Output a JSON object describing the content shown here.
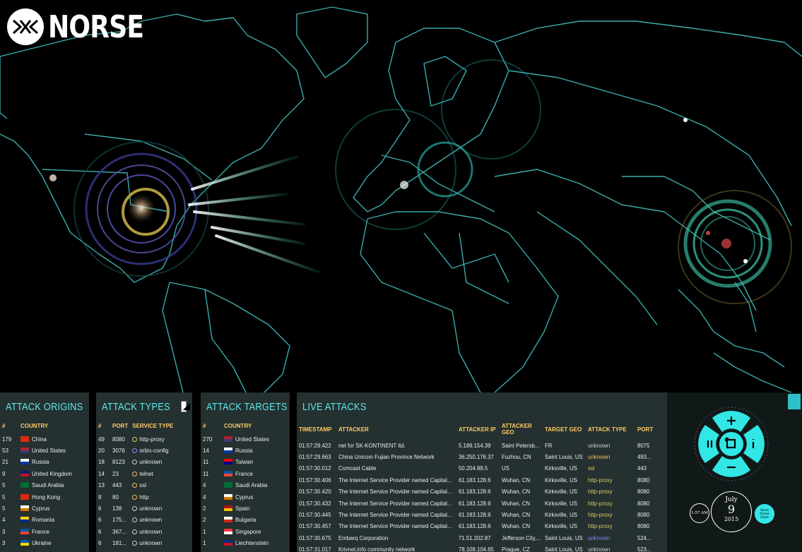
{
  "brand": {
    "name": "NORSE"
  },
  "colors": {
    "accent": "#5fe6e6",
    "header_text": "#ffcc66",
    "map_lines": "#3fb6b6",
    "panel_bg": "#283434"
  },
  "origins": {
    "title": "ATTACK ORIGINS",
    "headers": [
      "#",
      "COUNTRY"
    ],
    "rows": [
      {
        "count": "179",
        "country": "China",
        "flag": "CN"
      },
      {
        "count": "53",
        "country": "United States",
        "flag": "US"
      },
      {
        "count": "21",
        "country": "Russia",
        "flag": "RU"
      },
      {
        "count": "9",
        "country": "United Kingdom",
        "flag": "GB"
      },
      {
        "count": "5",
        "country": "Saudi Arabia",
        "flag": "SA"
      },
      {
        "count": "5",
        "country": "Hong Kong",
        "flag": "HK"
      },
      {
        "count": "5",
        "country": "Cyprus",
        "flag": "CY"
      },
      {
        "count": "4",
        "country": "Romania",
        "flag": "RO"
      },
      {
        "count": "3",
        "country": "France",
        "flag": "FR"
      },
      {
        "count": "3",
        "country": "Ukraine",
        "flag": "UA"
      }
    ]
  },
  "types": {
    "title": "ATTACK TYPES",
    "headers": [
      "#",
      "PORT",
      "SERVICE TYPE"
    ],
    "rows": [
      {
        "count": "49",
        "port": "8080",
        "service": "http-proxy",
        "color": "#d9c96a"
      },
      {
        "count": "20",
        "port": "3076",
        "service": "orbix-config",
        "color": "#8a8af0"
      },
      {
        "count": "18",
        "port": "8123",
        "service": "unknown",
        "color": "#cfcfcf"
      },
      {
        "count": "14",
        "port": "23",
        "service": "telnet",
        "color": "#f0c060"
      },
      {
        "count": "13",
        "port": "443",
        "service": "ssl",
        "color": "#f0c060"
      },
      {
        "count": "8",
        "port": "80",
        "service": "http",
        "color": "#f0c060"
      },
      {
        "count": "6",
        "port": "138",
        "service": "unknown",
        "color": "#cfcfcf"
      },
      {
        "count": "6",
        "port": "175...",
        "service": "unknown",
        "color": "#cfcfcf"
      },
      {
        "count": "6",
        "port": "367...",
        "service": "unknown",
        "color": "#cfcfcf"
      },
      {
        "count": "6",
        "port": "181...",
        "service": "unknown",
        "color": "#cfcfcf"
      }
    ]
  },
  "targets": {
    "title": "ATTACK TARGETS",
    "headers": [
      "#",
      "COUNTRY"
    ],
    "rows": [
      {
        "count": "270",
        "country": "United States",
        "flag": "US"
      },
      {
        "count": "14",
        "country": "Russia",
        "flag": "RU"
      },
      {
        "count": "11",
        "country": "Taiwan",
        "flag": "TW"
      },
      {
        "count": "11",
        "country": "France",
        "flag": "FR"
      },
      {
        "count": "4",
        "country": "Saudi Arabia",
        "flag": "SA"
      },
      {
        "count": "4",
        "country": "Cyprus",
        "flag": "CY"
      },
      {
        "count": "2",
        "country": "Spain",
        "flag": "ES"
      },
      {
        "count": "2",
        "country": "Bulgaria",
        "flag": "BG"
      },
      {
        "count": "1",
        "country": "Singapore",
        "flag": "SG"
      },
      {
        "count": "1",
        "country": "Liechtenstein",
        "flag": "LI"
      }
    ]
  },
  "live": {
    "title": "LIVE ATTACKS",
    "headers": [
      "TIMESTAMP",
      "ATTACKER",
      "ATTACKER IP",
      "ATTACKER GEO",
      "TARGET GEO",
      "ATTACK TYPE",
      "PORT"
    ],
    "rows": [
      {
        "ts": "01:57:29.422",
        "attacker": "net for SK-KONTINENT ltd.",
        "ip": "5.189.154.39",
        "ageo": "Saint Petersb...",
        "tgeo": "FR",
        "type": "unknown",
        "port": "8075",
        "tc": "#cfcfcf"
      },
      {
        "ts": "01:57:29.663",
        "attacker": "China Unicom Fujian Province Network",
        "ip": "36.250.176.37",
        "ageo": "Fuzhou, CN",
        "tgeo": "Saint Louis, US",
        "type": "unknown",
        "port": "493...",
        "tc": "#f0c060"
      },
      {
        "ts": "01:57:30.012",
        "attacker": "Comcast Cable",
        "ip": "50.204.88.5",
        "ageo": "US",
        "tgeo": "Kirksville, US",
        "type": "ssl",
        "port": "443",
        "tc": "#f0c060"
      },
      {
        "ts": "01:57:30.406",
        "attacker": "The Internet Service Provider named Capital...",
        "ip": "61.183.128.6",
        "ageo": "Wuhan, CN",
        "tgeo": "Kirksville, US",
        "type": "http-proxy",
        "port": "8080",
        "tc": "#d9c96a"
      },
      {
        "ts": "01:57:30.420",
        "attacker": "The Internet Service Provider named Capital...",
        "ip": "61.183.128.6",
        "ageo": "Wuhan, CN",
        "tgeo": "Kirksville, US",
        "type": "http-proxy",
        "port": "8080",
        "tc": "#d9c96a"
      },
      {
        "ts": "01:57:30.432",
        "attacker": "The Internet Service Provider named Capital...",
        "ip": "61.183.128.6",
        "ageo": "Wuhan, CN",
        "tgeo": "Kirksville, US",
        "type": "http-proxy",
        "port": "8080",
        "tc": "#d9c96a"
      },
      {
        "ts": "01:57:30.445",
        "attacker": "The Internet Service Provider named Capital...",
        "ip": "61.183.128.6",
        "ageo": "Wuhan, CN",
        "tgeo": "Kirksville, US",
        "type": "http-proxy",
        "port": "8080",
        "tc": "#d9c96a"
      },
      {
        "ts": "01:57:30.457",
        "attacker": "The Internet Service Provider named Capital...",
        "ip": "61.183.128.6",
        "ageo": "Wuhan, CN",
        "tgeo": "Kirksville, US",
        "type": "http-proxy",
        "port": "8080",
        "tc": "#d9c96a"
      },
      {
        "ts": "01:57:30.675",
        "attacker": "Embarq Corporation",
        "ip": "71.51.202.87",
        "ageo": "Jefferson City,...",
        "tgeo": "Saint Louis, US",
        "type": "unknown",
        "port": "524...",
        "tc": "#8a8af0"
      },
      {
        "ts": "01:57:31.017",
        "attacker": "Krivnet.info community network",
        "ip": "78.108.104.65",
        "ageo": "Prague, CZ",
        "tgeo": "Saint Louis, US",
        "type": "unknown",
        "port": "523...",
        "tc": "#cfcfcf"
      }
    ]
  },
  "controls": {
    "time": "1:57 AM",
    "month": "July",
    "day": "9",
    "year": "2015",
    "stats_label": "Show Norse Stats",
    "icons": [
      "zoom-in-icon",
      "zoom-out-icon",
      "pause-icon",
      "info-icon",
      "fullscreen-icon"
    ]
  }
}
